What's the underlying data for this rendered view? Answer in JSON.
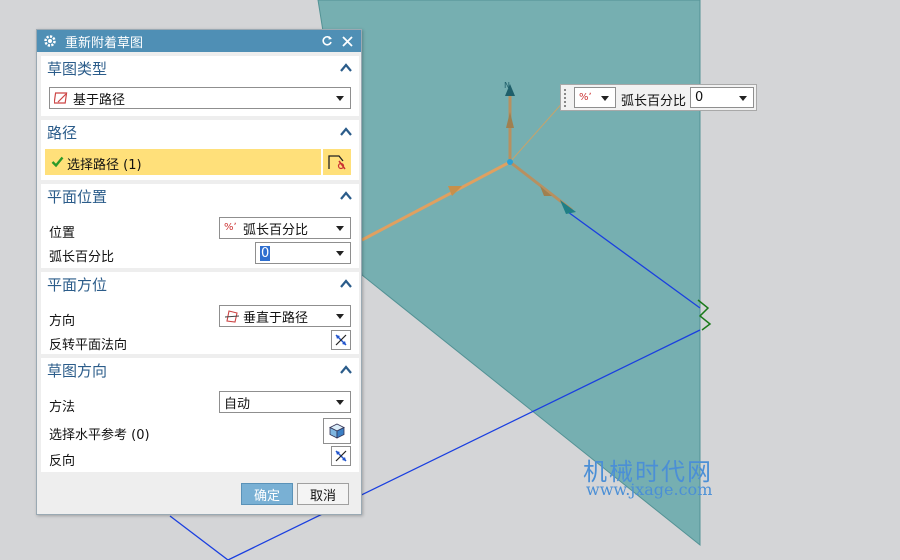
{
  "dialog": {
    "title": "重新附着草图",
    "sections": {
      "sketch_type": {
        "header": "草图类型",
        "value": "基于路径"
      },
      "path": {
        "header": "路径",
        "select_label": "选择路径 (1)"
      },
      "plane_position": {
        "header": "平面位置",
        "position_label": "位置",
        "position_value": "弧长百分比",
        "arc_label": "弧长百分比",
        "arc_value": "0"
      },
      "plane_orientation": {
        "header": "平面方位",
        "direction_label": "方向",
        "direction_value": "垂直于路径",
        "reverse_label": "反转平面法向"
      },
      "sketch_orientation": {
        "header": "草图方向",
        "method_label": "方法",
        "method_value": "自动",
        "ref_label": "选择水平参考 (0)",
        "reverse_label": "反向"
      }
    },
    "ok_label": "确定",
    "cancel_label": "取消"
  },
  "float_toolbar": {
    "label": "弧长百分比",
    "value": "0"
  },
  "axis_label": "N",
  "watermark": {
    "line1": "机械时代网",
    "line2": "www.jxage.com"
  },
  "colors": {
    "plane": "#72adaf",
    "title_bar": "#4f8fb5",
    "selected_row": "#ffe07a",
    "path_line": "#1a3fe0"
  }
}
